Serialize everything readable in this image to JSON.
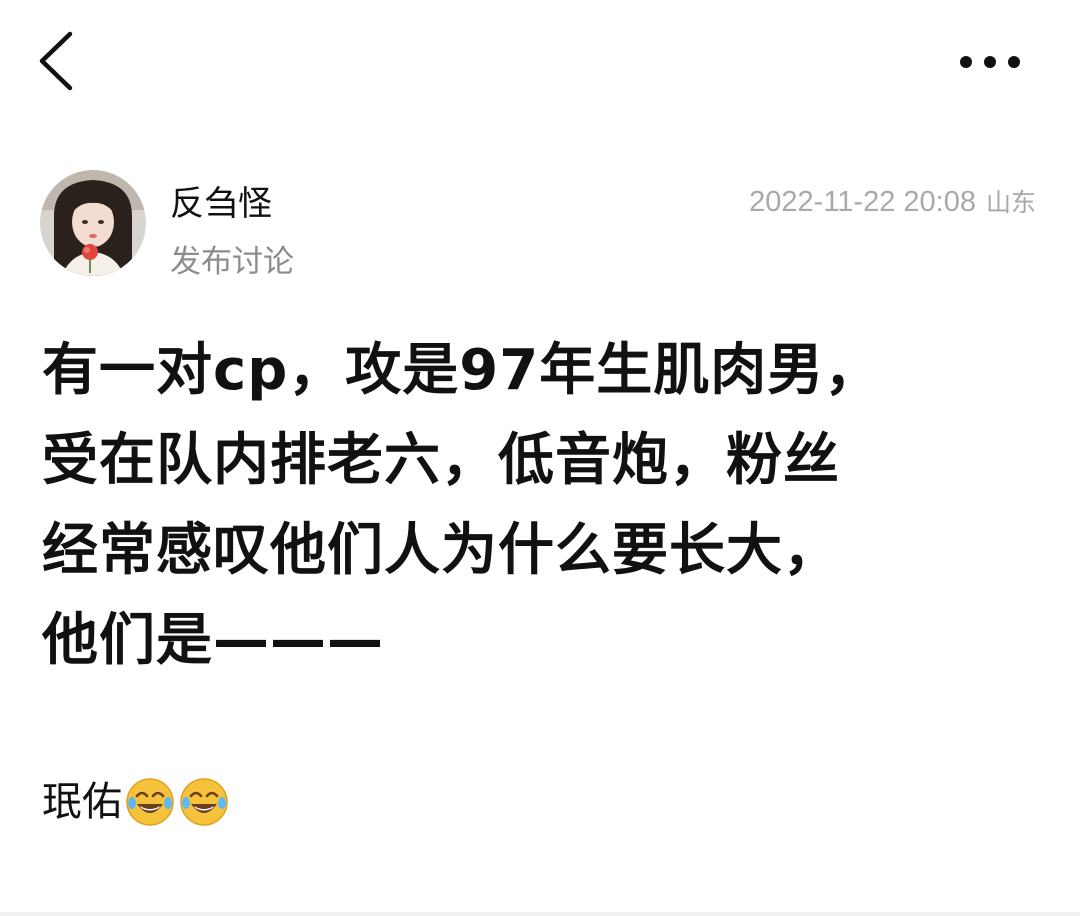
{
  "topbar": {
    "back_icon": "chevron-left-icon",
    "more_icon": "more-horizontal-icon"
  },
  "post": {
    "author": {
      "name": "反刍怪",
      "avatar_icon": "avatar-photo"
    },
    "type_label": "发布讨论",
    "timestamp": "2022-11-22 20:08",
    "location": "山东",
    "body_lines": [
      "有一对cp，攻是97年生肌肉男，",
      "受在队内排老六，低音炮，粉丝",
      "经常感叹他们人为什么要长大，",
      "他们是———"
    ],
    "footnote_text": "珉佑",
    "footnote_emojis": [
      "tears-of-joy-emoji",
      "tears-of-joy-emoji"
    ]
  },
  "colors": {
    "text_primary": "#111111",
    "text_secondary": "#8c8c8c",
    "text_meta": "#a9a9a9",
    "background": "#ffffff"
  }
}
